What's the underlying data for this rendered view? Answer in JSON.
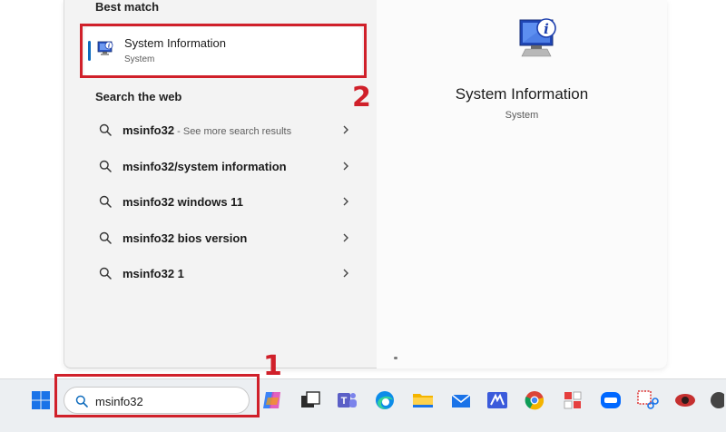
{
  "best_match": {
    "heading": "Best match",
    "title": "System Information",
    "subtitle": "System"
  },
  "search_web": {
    "heading": "Search the web",
    "items": [
      {
        "text": "msinfo32",
        "hint": " - See more search results"
      },
      {
        "text": "msinfo32/system information",
        "hint": ""
      },
      {
        "text": "msinfo32 windows 11",
        "hint": ""
      },
      {
        "text": "msinfo32 bios version",
        "hint": ""
      },
      {
        "text": "msinfo32 1",
        "hint": ""
      }
    ]
  },
  "preview": {
    "title": "System Information",
    "subtitle": "System"
  },
  "callouts": {
    "one": "1",
    "two": "2"
  },
  "taskbar": {
    "search_value": "msinfo32",
    "apps": [
      "copilot-icon",
      "task-view-icon",
      "teams-icon",
      "edge-icon",
      "file-explorer-icon",
      "mail-icon",
      "store-icon",
      "chrome-icon",
      "app-icon",
      "zalo-icon",
      "snipping-tool-icon",
      "eye-icon",
      "app-icon"
    ]
  },
  "colors": {
    "accent": "#0f6cbd",
    "highlight": "#d0202a"
  }
}
